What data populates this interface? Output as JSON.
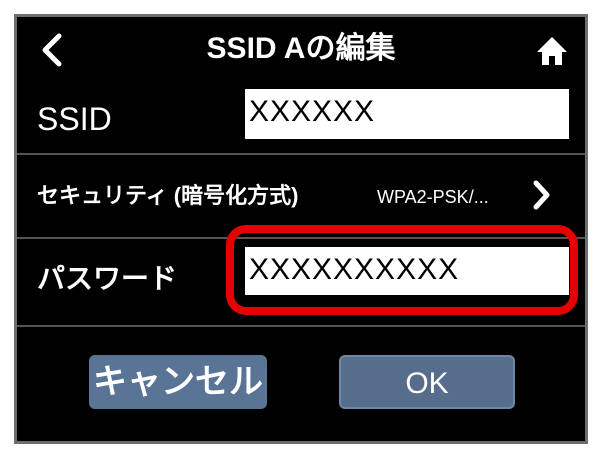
{
  "header": {
    "title": "SSID Aの編集",
    "back_icon": "back-arrow-icon",
    "home_icon": "home-icon"
  },
  "ssid": {
    "label": "SSID",
    "value": "XXXXXX"
  },
  "security": {
    "label": "セキュリティ (暗号化方式)",
    "value": "WPA2-PSK/...",
    "chevron_icon": "chevron-right-icon"
  },
  "password": {
    "label": "パスワード",
    "value": "XXXXXXXXXX",
    "highlight_color": "#e60000"
  },
  "buttons": {
    "cancel": "キャンセル",
    "ok": "OK"
  },
  "colors": {
    "background": "#000000",
    "button": "#5a7496",
    "highlight": "#e60000"
  }
}
